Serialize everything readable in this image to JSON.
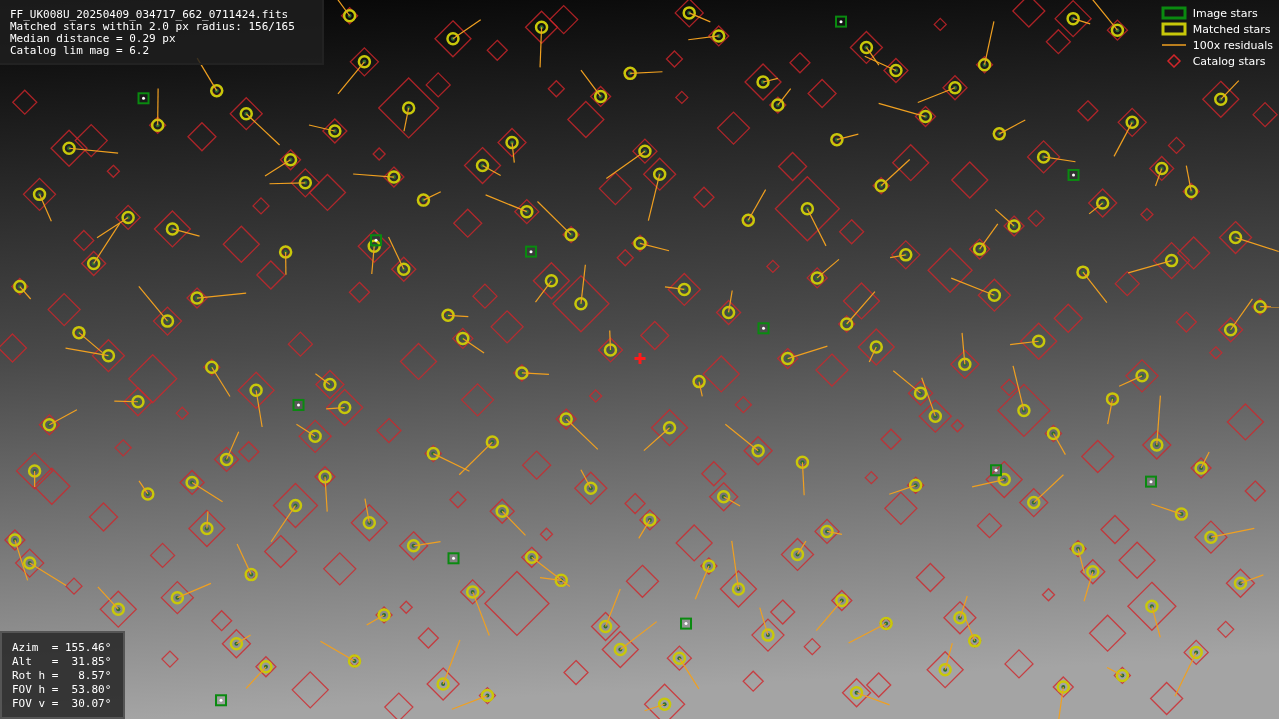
{
  "info_panel": {
    "lines": [
      "FF_UK008U_20250409_034717_662_0711424.fits",
      "Matched stars within 2.0 px radius: 156/165",
      "Median distance = 0.29 px",
      "Catalog lim mag = 6.2"
    ]
  },
  "legend": [
    {
      "kind": "image",
      "label": "Image stars"
    },
    {
      "kind": "matched",
      "label": "Matched stars"
    },
    {
      "kind": "residual",
      "label": "100x residuals"
    },
    {
      "kind": "catalog",
      "label": "Catalog stars"
    }
  ],
  "pointing_panel": {
    "lines": [
      "Azim  = 155.46°",
      "Alt   =  31.85°",
      "Rot h =   8.57°",
      "FOV h =  53.80°",
      "FOV v =  30.07°"
    ]
  }
}
